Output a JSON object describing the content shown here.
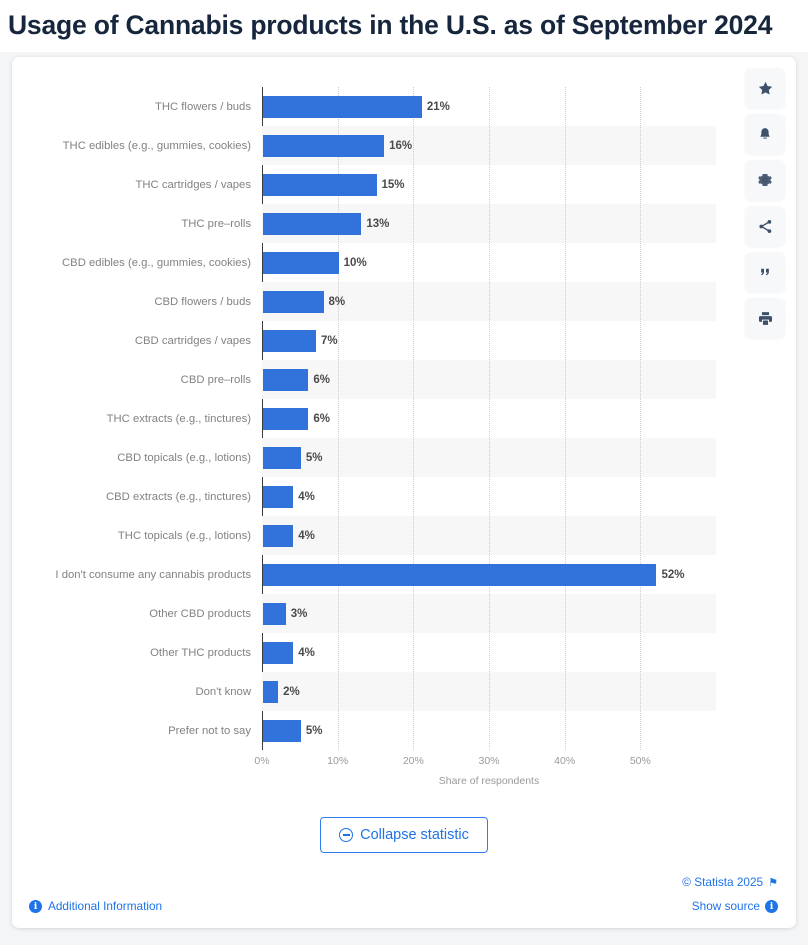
{
  "header": {
    "title": "Usage of Cannabis products in the U.S. as of September 2024"
  },
  "toolbar": {
    "items": [
      {
        "name": "favorite-icon",
        "glyph": "★",
        "label": "Add to favorites"
      },
      {
        "name": "alert-icon",
        "glyph": "🔔",
        "label": "Create alert"
      },
      {
        "name": "settings-icon",
        "glyph": "⚙",
        "label": "Settings"
      },
      {
        "name": "share-icon",
        "glyph": "↭",
        "label": "Share"
      },
      {
        "name": "citation-icon",
        "glyph": "“",
        "label": "Cite"
      },
      {
        "name": "print-icon",
        "glyph": "⎙",
        "label": "Print"
      }
    ]
  },
  "chart_data": {
    "type": "bar",
    "orientation": "horizontal",
    "title": "Usage of Cannabis products in the U.S. as of September 2024",
    "xlabel": "Share of respondents",
    "ylabel": "",
    "xlim": [
      0,
      60
    ],
    "xticks": [
      0,
      10,
      20,
      30,
      40,
      50
    ],
    "xtick_labels": [
      "0%",
      "10%",
      "20%",
      "30%",
      "40%",
      "50%"
    ],
    "grid": "vertical-dotted",
    "legend": "none",
    "bar_color": "#3173da",
    "categories": [
      "THC flowers / buds",
      "THC edibles (e.g., gummies, cookies)",
      "THC cartridges / vapes",
      "THC pre–rolls",
      "CBD edibles (e.g., gummies, cookies)",
      "CBD flowers / buds",
      "CBD cartridges / vapes",
      "CBD pre–rolls",
      "THC extracts (e.g., tinctures)",
      "CBD topicals (e.g., lotions)",
      "CBD extracts (e.g., tinctures)",
      "THC topicals (e.g., lotions)",
      "I don't consume any cannabis products",
      "Other CBD products",
      "Other THC products",
      "Don't know",
      "Prefer not to say"
    ],
    "values": [
      21,
      16,
      15,
      13,
      10,
      8,
      7,
      6,
      6,
      5,
      4,
      4,
      52,
      3,
      4,
      2,
      5
    ],
    "value_labels": [
      "21%",
      "16%",
      "15%",
      "13%",
      "10%",
      "8%",
      "7%",
      "6%",
      "6%",
      "5%",
      "4%",
      "4%",
      "52%",
      "3%",
      "4%",
      "2%",
      "5%"
    ]
  },
  "footer": {
    "collapse_label": "Collapse statistic",
    "additional_information": "Additional Information",
    "copyright": "© Statista 2025",
    "show_source": "Show source"
  }
}
